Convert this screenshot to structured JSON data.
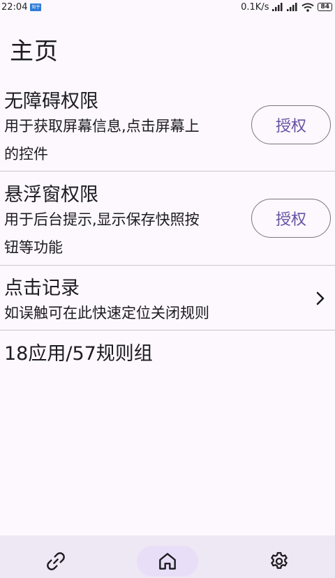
{
  "status_bar": {
    "time": "22:04",
    "notif_badge": "知乎",
    "net_speed": "0.1K/s",
    "battery": "84"
  },
  "page": {
    "title": "主页"
  },
  "accessibility": {
    "title": "无障碍权限",
    "desc_line1": "用于获取屏幕信息,点击屏幕上",
    "desc_line2": "的控件",
    "button": "授权"
  },
  "floating_window": {
    "title": "悬浮窗权限",
    "desc_line1": "用于后台提示,显示保存快照按",
    "desc_line2": "钮等功能",
    "button": "授权"
  },
  "click_log": {
    "title": "点击记录",
    "desc": "如误触可在此快速定位关闭规则"
  },
  "summary": "18应用/57规则组",
  "bottom_nav": {
    "items": [
      "link-icon",
      "home-icon",
      "gear-icon"
    ],
    "active": "home-icon"
  },
  "colors": {
    "accent": "#6750a4",
    "nav_bg": "#eee8f4",
    "active_pill": "#e8def8"
  }
}
